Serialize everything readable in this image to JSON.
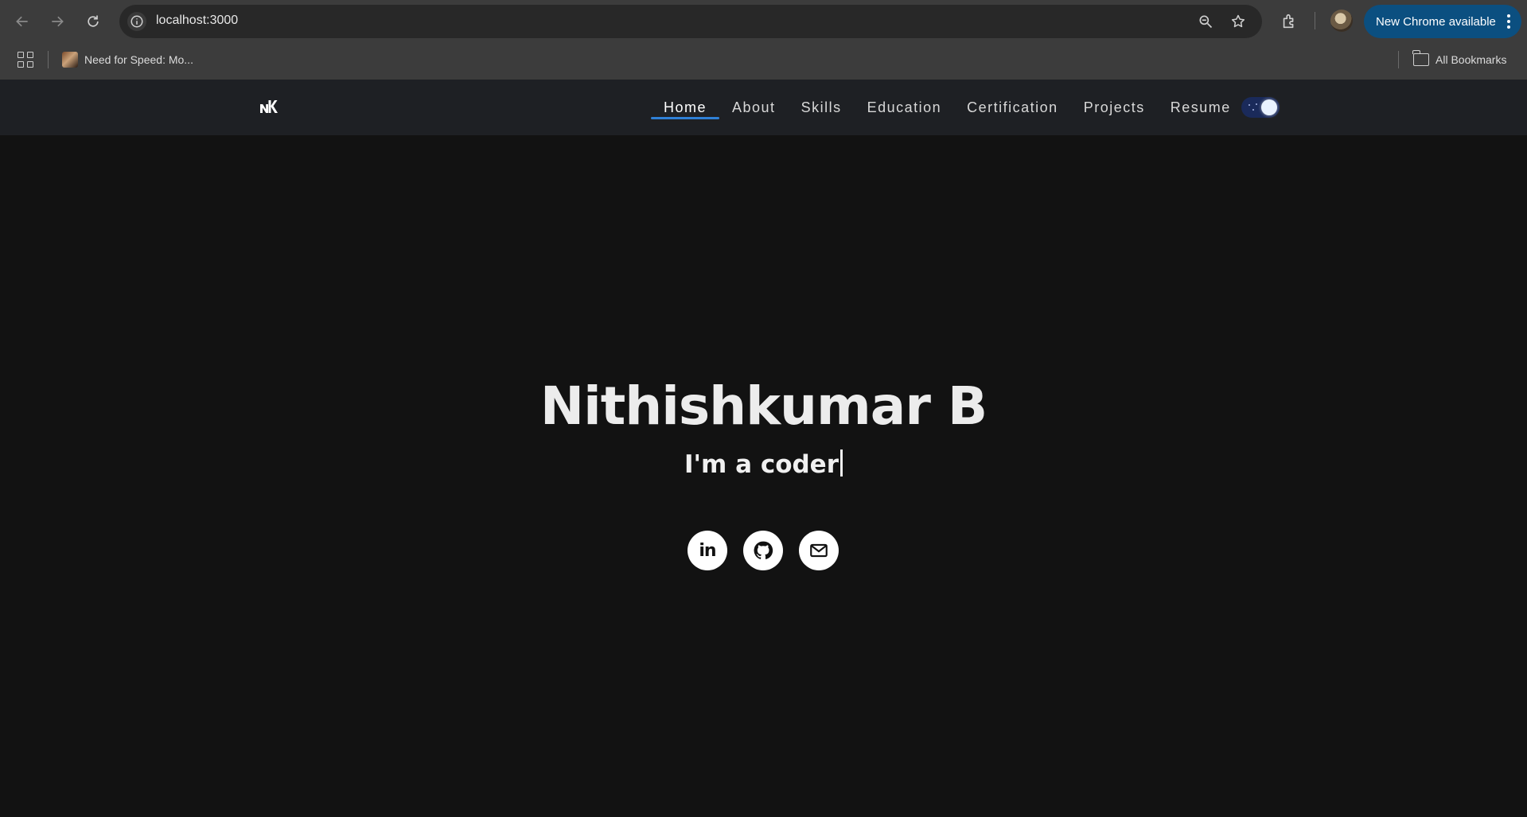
{
  "browser": {
    "url": "localhost:3000",
    "update_label": "New Chrome available",
    "bookmarks": [
      {
        "label": "Need for Speed: Mo..."
      }
    ],
    "all_bookmarks_label": "All Bookmarks"
  },
  "site": {
    "logo_text": "NK",
    "nav": [
      {
        "label": "Home",
        "active": true
      },
      {
        "label": "About"
      },
      {
        "label": "Skills"
      },
      {
        "label": "Education"
      },
      {
        "label": "Certification"
      },
      {
        "label": "Projects"
      },
      {
        "label": "Resume"
      }
    ],
    "theme": "dark"
  },
  "hero": {
    "name": "Nithishkumar B",
    "tagline": "I'm a coder",
    "socials": [
      {
        "label": "in",
        "icon": "linkedin-icon"
      },
      {
        "icon": "github-icon"
      },
      {
        "icon": "mail-icon"
      }
    ]
  },
  "colors": {
    "page_bg": "#121212",
    "nav_bg": "#1e2024",
    "active_underline": "#2f80d6",
    "chrome_update": "#0b4f80"
  }
}
